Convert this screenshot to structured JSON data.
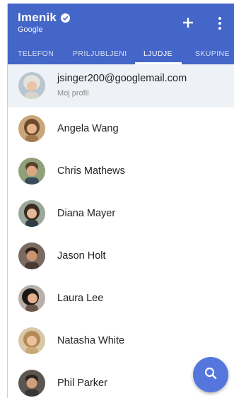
{
  "app": {
    "title": "Imenik",
    "subtitle": "Google",
    "header_color": "#4466c8",
    "accent": "#5577dd"
  },
  "tabs": [
    {
      "label": "TELEFON",
      "active": false
    },
    {
      "label": "PRILJUBLJENI",
      "active": false
    },
    {
      "label": "LJUDJE",
      "active": true
    },
    {
      "label": "SKUPINE",
      "active": false
    }
  ],
  "profile": {
    "email": "jsinger200@googlemail.com",
    "label": "Moj profil"
  },
  "contacts": [
    {
      "name": "Angela Wang"
    },
    {
      "name": "Chris Mathews"
    },
    {
      "name": "Diana Mayer"
    },
    {
      "name": "Jason Holt"
    },
    {
      "name": "Laura Lee"
    },
    {
      "name": "Natasha White"
    },
    {
      "name": "Phil Parker"
    }
  ],
  "icons": {
    "verified": "check-circle-icon",
    "add": "plus-icon",
    "menu": "more-vertical-icon",
    "fab": "search-icon"
  }
}
